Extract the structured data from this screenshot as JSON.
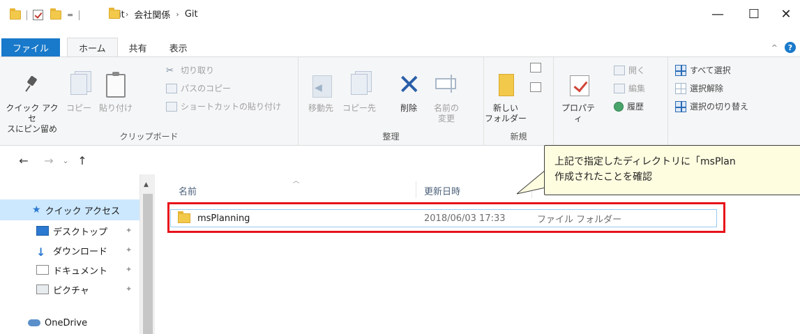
{
  "window": {
    "title": "Git",
    "qat_dropdown": "=",
    "controls": {
      "minimize": "—",
      "maximize": "☐",
      "close": "✕"
    }
  },
  "ribbon_tabs": [
    {
      "label": "ファイル"
    },
    {
      "label": "ホーム"
    },
    {
      "label": "共有"
    },
    {
      "label": "表示"
    }
  ],
  "ribbon": {
    "clipboard": {
      "label": "クリップボード",
      "pin_line1": "クイック アクセ",
      "pin_line2": "スにピン留め",
      "copy": "コピー",
      "paste": "貼り付け",
      "cut": "切り取り",
      "copy_path": "パスのコピー",
      "paste_shortcut": "ショートカットの貼り付け"
    },
    "organize": {
      "label": "整理",
      "move_to": "移動先",
      "copy_to": "コピー先",
      "delete": "削除",
      "rename_line1": "名前の",
      "rename_line2": "変更"
    },
    "new": {
      "label": "新規",
      "new_folder_line1": "新しい",
      "new_folder_line2": "フォルダー"
    },
    "open": {
      "properties": "プロパティ",
      "open": "開く",
      "edit": "編集",
      "history": "履歴"
    },
    "select": {
      "select_all": "すべて選択",
      "select_none": "選択解除",
      "invert": "選択の切り替え"
    }
  },
  "address": {
    "crumbs": [
      "会社関係",
      "Git"
    ]
  },
  "nav_pane": {
    "quick_access": "クイック アクセス",
    "items": [
      {
        "label": "デスクトップ"
      },
      {
        "label": "ダウンロード"
      },
      {
        "label": "ドキュメント"
      },
      {
        "label": "ピクチャ"
      }
    ],
    "onedrive": "OneDrive"
  },
  "file_list": {
    "columns": {
      "name": "名前",
      "date": "更新日時"
    },
    "rows": [
      {
        "name": "msPlanning",
        "date": "2018/06/03 17:33",
        "type": "ファイル フォルダー"
      }
    ]
  },
  "callout": {
    "line1": "上記で指定したディレクトリに「msPlan",
    "line2": "作成されたことを確認"
  },
  "colors": {
    "file_tab": "#1979ca",
    "highlight": "#e8121a",
    "callout_bg": "#fffde0",
    "selection": "#cce8ff"
  }
}
